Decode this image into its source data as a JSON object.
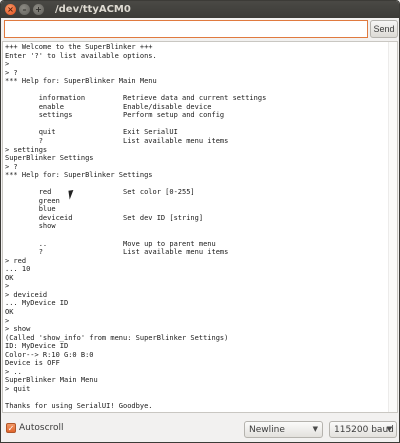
{
  "window": {
    "title": "/dev/ttyACM0",
    "close_glyph": "×",
    "min_glyph": "–",
    "max_glyph": "+"
  },
  "toolbar": {
    "input_value": "",
    "send_label": "Send"
  },
  "console_lines": [
    "+++ Welcome to the SuperBlinker +++",
    "Enter '?' to list available options.",
    ">",
    "> ?",
    "*** Help for: SuperBlinker Main Menu",
    "",
    "\tinformation         Retrieve data and current settings",
    "\tenable              Enable/disable device",
    "\tsettings            Perform setup and config",
    "",
    "\tquit                Exit SerialUI",
    "\t?                   List available menu items",
    "> settings",
    "SuperBlinker Settings",
    "> ?",
    "*** Help for: SuperBlinker Settings",
    "",
    "\tred                 Set color [0-255]",
    "\tgreen",
    "\tblue",
    "\tdeviceid            Set dev ID [string]",
    "\tshow",
    "",
    "\t..                  Move up to parent menu",
    "\t?                   List available menu items",
    "> red",
    "... 10",
    "OK",
    ">",
    "> deviceid",
    "... MyDevice ID",
    "OK",
    ">",
    "> show",
    "(Called 'show_info' from menu: SuperBlinker Settings)",
    "ID: MyDevice ID",
    "Color--> R:10 G:0 B:0",
    "Device is OFF",
    "> ..",
    "SuperBlinker Main Menu",
    "> quit",
    "",
    "Thanks for using SerialUI! Goodbye."
  ],
  "statusbar": {
    "autoscroll_label": "Autoscroll",
    "autoscroll_checked": true,
    "check_glyph": "✓",
    "line_ending": "Newline",
    "baud_rate": "115200 baud",
    "dropdown_glyph": "▼"
  },
  "colors": {
    "accent": "#e0652c",
    "titlebar": "#3c3b37"
  }
}
